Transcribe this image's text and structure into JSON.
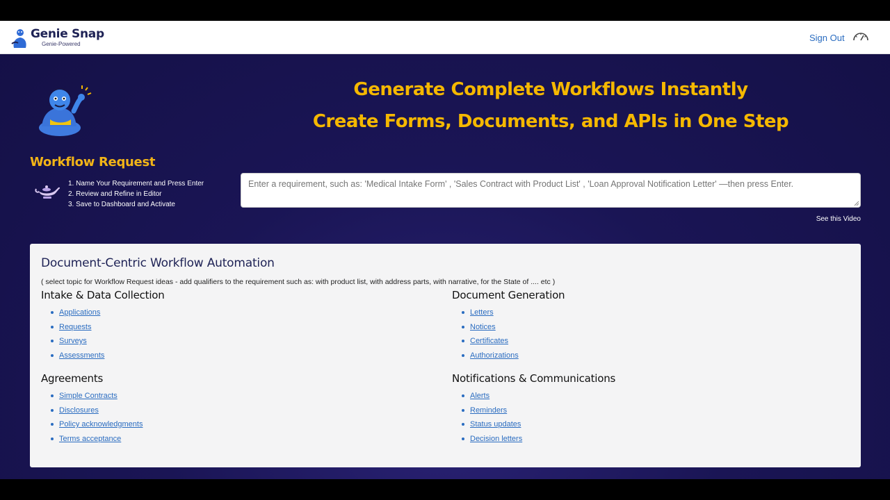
{
  "brand": {
    "name": "Genie Snap",
    "tagline": "Genie-Powered"
  },
  "nav": {
    "sign_out": "Sign Out"
  },
  "hero": {
    "line1": "Generate Complete Workflows Instantly",
    "line2": "Create Forms, Documents, and APIs in One Step"
  },
  "workflow_request": {
    "title": "Workflow Request",
    "steps": [
      "1. Name Your Requirement and Press Enter",
      "2. Review and Refine in Editor",
      "3. Save to Dashboard and Activate"
    ],
    "input_placeholder": "Enter a requirement, such as: 'Medical Intake Form' , 'Sales Contract with Product List' , 'Loan Approval Notification Letter' —then press Enter.",
    "video_link": "See this Video"
  },
  "topics": {
    "title": "Document-Centric Workflow Automation",
    "hint": "( select topic for Workflow Request ideas - add qualifiers to the requirement such as: with product list, with address parts, with narrative, for the State of .... etc )",
    "categories": [
      {
        "name": "Intake & Data Collection",
        "items": [
          "Applications",
          "Requests",
          "Surveys",
          "Assessments"
        ]
      },
      {
        "name": "Document Generation",
        "items": [
          "Letters",
          "Notices",
          "Certificates",
          "Authorizations"
        ]
      },
      {
        "name": "Agreements",
        "items": [
          "Simple Contracts",
          "Disclosures",
          "Policy acknowledgments",
          "Terms acceptance"
        ]
      },
      {
        "name": "Notifications & Communications",
        "items": [
          "Alerts",
          "Reminders",
          "Status updates",
          "Decision letters"
        ]
      }
    ]
  },
  "colors": {
    "accent_gold": "#f5b800",
    "link_blue": "#2a6cc0",
    "background_navy": "#1a1555"
  },
  "icons": [
    "genie-logo-icon",
    "gauge-icon",
    "genie-mascot",
    "lamp-icon"
  ]
}
